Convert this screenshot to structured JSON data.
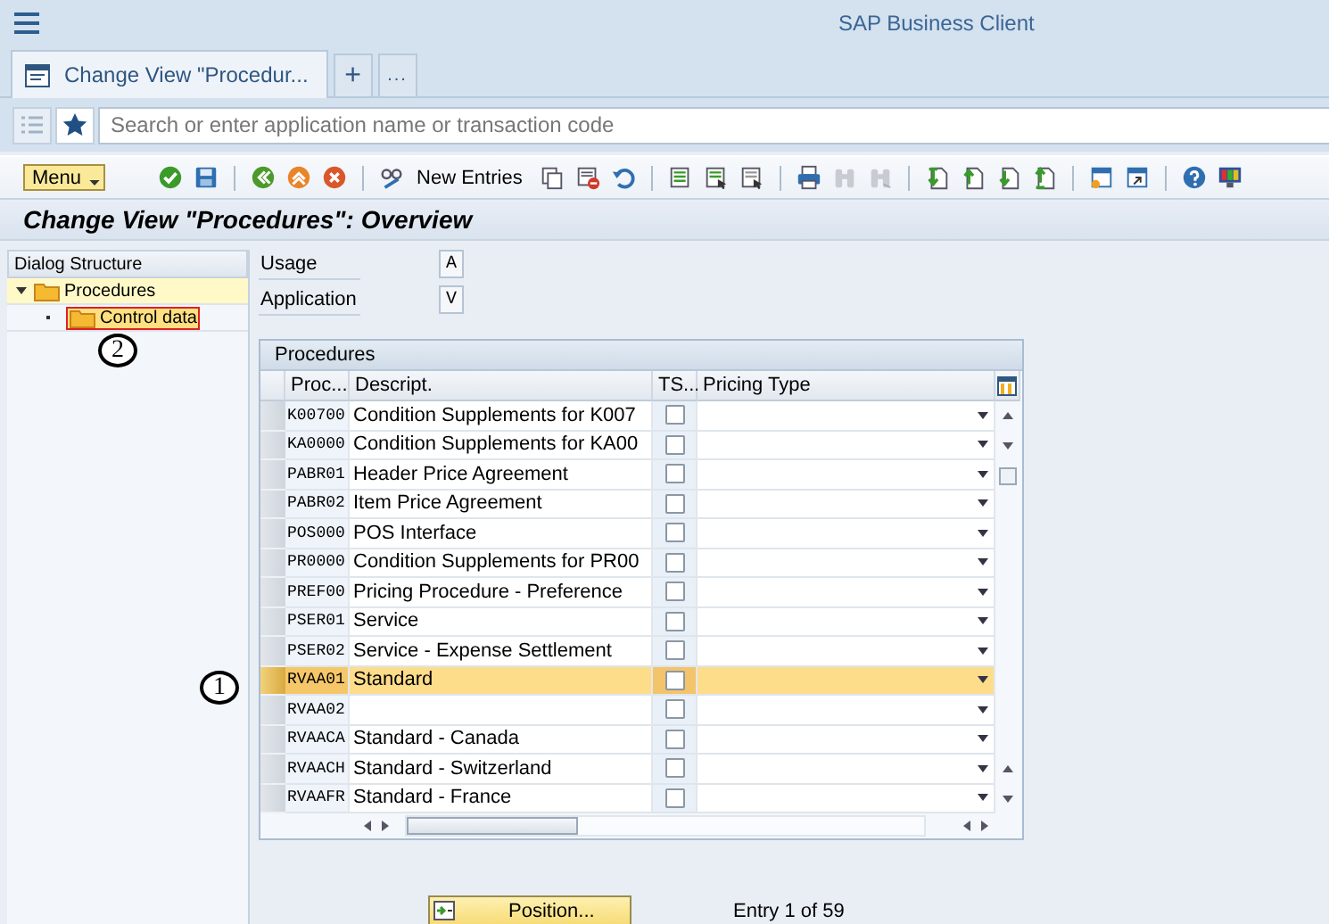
{
  "window": {
    "title": "SAP Business Client"
  },
  "tabs": [
    {
      "label": "Change View \"Procedur...",
      "selected": true
    }
  ],
  "tab_actions": {
    "new_tab": "+",
    "more": "..."
  },
  "search": {
    "placeholder": "Search or enter application name or transaction code"
  },
  "toolbar": {
    "menu": "Menu",
    "new_entries": "New Entries"
  },
  "screen_title": "Change View \"Procedures\": Overview",
  "dialog_structure": {
    "title": "Dialog Structure",
    "items": [
      {
        "label": "Procedures",
        "expanded": true,
        "selected": false,
        "children": [
          {
            "label": "Control data",
            "selected": true
          }
        ]
      }
    ]
  },
  "fields": [
    {
      "label": "Usage",
      "value": "A"
    },
    {
      "label": "Application",
      "value": "V"
    }
  ],
  "table": {
    "title": "Procedures",
    "columns": [
      "Proc...",
      "Descript.",
      "TS...",
      "Pricing Type"
    ],
    "rows": [
      {
        "procedure": "K00700",
        "description": "Condition Supplements for K007",
        "checked": false,
        "selected": false
      },
      {
        "procedure": "KA0000",
        "description": "Condition Supplements for KA00",
        "checked": false,
        "selected": false
      },
      {
        "procedure": "PABR01",
        "description": "Header Price Agreement",
        "checked": false,
        "selected": false
      },
      {
        "procedure": "PABR02",
        "description": "Item Price Agreement",
        "checked": false,
        "selected": false
      },
      {
        "procedure": "POS000",
        "description": "POS Interface",
        "checked": false,
        "selected": false
      },
      {
        "procedure": "PR0000",
        "description": "Condition Supplements for PR00",
        "checked": false,
        "selected": false
      },
      {
        "procedure": "PREF00",
        "description": "Pricing Procedure - Preference",
        "checked": false,
        "selected": false
      },
      {
        "procedure": "PSER01",
        "description": "Service",
        "checked": false,
        "selected": false
      },
      {
        "procedure": "PSER02",
        "description": "Service - Expense Settlement",
        "checked": false,
        "selected": false
      },
      {
        "procedure": "RVAA01",
        "description": "Standard",
        "checked": false,
        "selected": true
      },
      {
        "procedure": "RVAA02",
        "checked": false,
        "selected": false
      },
      {
        "procedure": "RVAACA",
        "description": "Standard - Canada",
        "checked": false,
        "selected": false
      },
      {
        "procedure": "RVAACH",
        "description": "Standard - Switzerland",
        "checked": false,
        "selected": false
      },
      {
        "procedure": "RVAAFR",
        "description": "Standard - France",
        "checked": false,
        "selected": false
      }
    ]
  },
  "position_button": "Position...",
  "entry_count": "Entry 1 of 59",
  "annotations": [
    {
      "label": "1"
    },
    {
      "label": "2"
    }
  ]
}
